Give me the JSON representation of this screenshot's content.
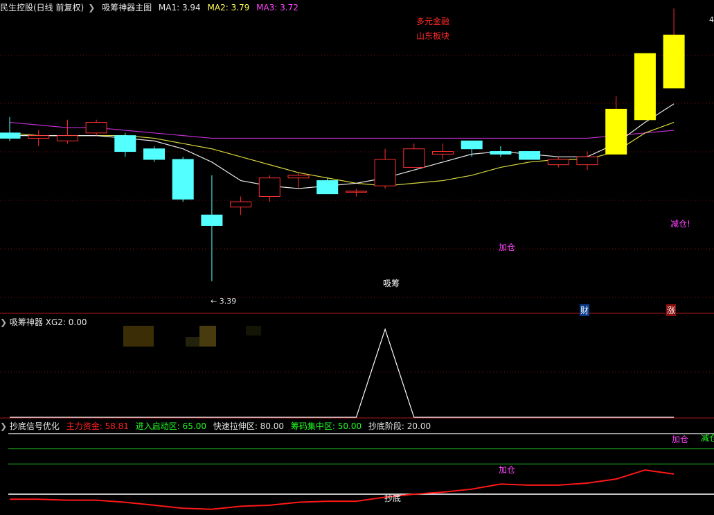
{
  "header": {
    "stock": "民生控股(日线 前复权)",
    "indicator": "吸筹神器主图",
    "ma1": "MA1: 3.94",
    "ma2": "MA2: 3.79",
    "ma3": "MA3: 3.72"
  },
  "concepts": [
    "多元金融",
    "山东板块"
  ],
  "main_labels": {
    "low_price": "3.39",
    "xichou": "吸筹",
    "jiacang": "加仓",
    "jiancang": "减仓!",
    "cai": "财",
    "zhang": "涨",
    "top_price": "4"
  },
  "panel2": {
    "title": "吸筹神器",
    "xg2": "XG2: 0.00"
  },
  "panel3": {
    "title": "抄底信号优化",
    "items": [
      {
        "label": "主力资金: 58.81",
        "color": "#ff2020"
      },
      {
        "label": "进入启动区: 65.00",
        "color": "#22ff22"
      },
      {
        "label": "快速拉伸区: 80.00",
        "color": "#e0e0e0"
      },
      {
        "label": "筹码集中区: 50.00",
        "color": "#22ff22"
      },
      {
        "label": "抄底阶段: 20.00",
        "color": "#e0e0e0"
      }
    ],
    "labels": {
      "chaodi": "抄底",
      "jiacang": "加仓",
      "jiacang2": "加仓",
      "jiancang": "减仓"
    }
  },
  "chart_data": {
    "type": "candlestick",
    "price_range": [
      3.3,
      4.4
    ],
    "candles": [
      {
        "o": 3.95,
        "h": 4.01,
        "l": 3.92,
        "c": 3.93
      },
      {
        "o": 3.93,
        "h": 3.96,
        "l": 3.9,
        "c": 3.94
      },
      {
        "o": 3.92,
        "h": 4.0,
        "l": 3.91,
        "c": 3.94
      },
      {
        "o": 3.95,
        "h": 4.0,
        "l": 3.94,
        "c": 3.99
      },
      {
        "o": 3.94,
        "h": 3.95,
        "l": 3.86,
        "c": 3.88
      },
      {
        "o": 3.89,
        "h": 3.9,
        "l": 3.84,
        "c": 3.85
      },
      {
        "o": 3.85,
        "h": 3.86,
        "l": 3.69,
        "c": 3.7
      },
      {
        "o": 3.64,
        "h": 3.79,
        "l": 3.39,
        "c": 3.6
      },
      {
        "o": 3.67,
        "h": 3.71,
        "l": 3.64,
        "c": 3.69
      },
      {
        "o": 3.71,
        "h": 3.79,
        "l": 3.69,
        "c": 3.78
      },
      {
        "o": 3.78,
        "h": 3.8,
        "l": 3.74,
        "c": 3.79
      },
      {
        "o": 3.77,
        "h": 3.78,
        "l": 3.72,
        "c": 3.72
      },
      {
        "o": 3.73,
        "h": 3.74,
        "l": 3.71,
        "c": 3.73
      },
      {
        "o": 3.75,
        "h": 3.89,
        "l": 3.74,
        "c": 3.85
      },
      {
        "o": 3.82,
        "h": 3.91,
        "l": 3.82,
        "c": 3.89
      },
      {
        "o": 3.87,
        "h": 3.91,
        "l": 3.85,
        "c": 3.88
      },
      {
        "o": 3.92,
        "h": 3.92,
        "l": 3.86,
        "c": 3.89
      },
      {
        "o": 3.88,
        "h": 3.9,
        "l": 3.86,
        "c": 3.87
      },
      {
        "o": 3.88,
        "h": 3.88,
        "l": 3.85,
        "c": 3.85
      },
      {
        "o": 3.83,
        "h": 3.86,
        "l": 3.82,
        "c": 3.85
      },
      {
        "o": 3.83,
        "h": 3.88,
        "l": 3.81,
        "c": 3.86
      },
      {
        "o": 3.87,
        "h": 4.09,
        "l": 3.87,
        "c": 4.04
      },
      {
        "o": 4.0,
        "h": 4.25,
        "l": 4.0,
        "c": 4.25
      },
      {
        "o": 4.12,
        "h": 4.42,
        "l": 4.12,
        "c": 4.32
      }
    ],
    "ma_lines": {
      "MA1": [
        3.94,
        3.94,
        3.94,
        3.94,
        3.93,
        3.92,
        3.89,
        3.84,
        3.77,
        3.75,
        3.74,
        3.75,
        3.76,
        3.78,
        3.81,
        3.84,
        3.87,
        3.88,
        3.87,
        3.86,
        3.86,
        3.91,
        3.99,
        4.06
      ],
      "MA2": [
        3.95,
        3.94,
        3.94,
        3.94,
        3.94,
        3.93,
        3.91,
        3.89,
        3.86,
        3.83,
        3.8,
        3.78,
        3.76,
        3.75,
        3.76,
        3.77,
        3.79,
        3.82,
        3.84,
        3.85,
        3.85,
        3.88,
        3.95,
        3.99
      ],
      "MA3": [
        3.99,
        3.98,
        3.97,
        3.97,
        3.96,
        3.95,
        3.94,
        3.93,
        3.93,
        3.93,
        3.93,
        3.93,
        3.93,
        3.93,
        3.93,
        3.93,
        3.93,
        3.93,
        3.93,
        3.93,
        3.93,
        3.94,
        3.95,
        3.96
      ]
    },
    "xg2": [
      0,
      0,
      0,
      0,
      0,
      0,
      0,
      0,
      0,
      0,
      0,
      0,
      0,
      1,
      0,
      0,
      0,
      0,
      0,
      0,
      0,
      0,
      0,
      0
    ],
    "main_funds": [
      15,
      15,
      14,
      14,
      12,
      9,
      6,
      5,
      8,
      9,
      12,
      13,
      13,
      17,
      20,
      22,
      25,
      30,
      29,
      29,
      31,
      35,
      44,
      40
    ],
    "levels": [
      20,
      50,
      65,
      80
    ]
  }
}
